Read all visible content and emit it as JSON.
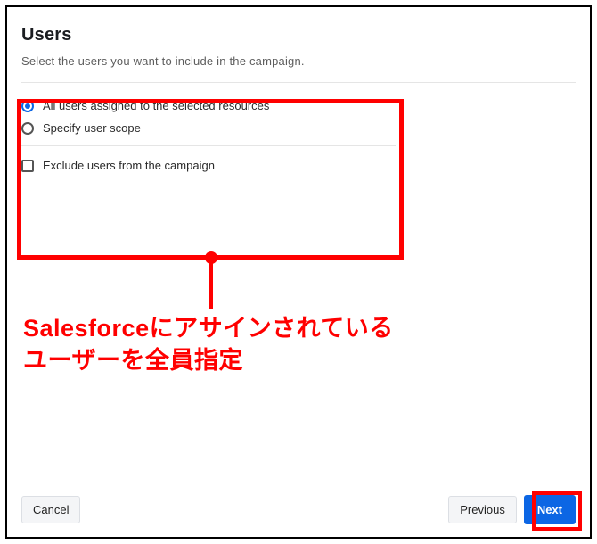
{
  "header": {
    "title": "Users",
    "subtitle": "Select the users you want to include in the campaign."
  },
  "options": {
    "radio": [
      {
        "label": "All users assigned to the selected resources",
        "selected": true
      },
      {
        "label": "Specify user scope",
        "selected": false
      }
    ],
    "exclude_label": "Exclude users from the campaign"
  },
  "annotation": {
    "text": "Salesforceにアサインされている\nユーザーを全員指定"
  },
  "footer": {
    "cancel": "Cancel",
    "previous": "Previous",
    "next": "Next"
  }
}
